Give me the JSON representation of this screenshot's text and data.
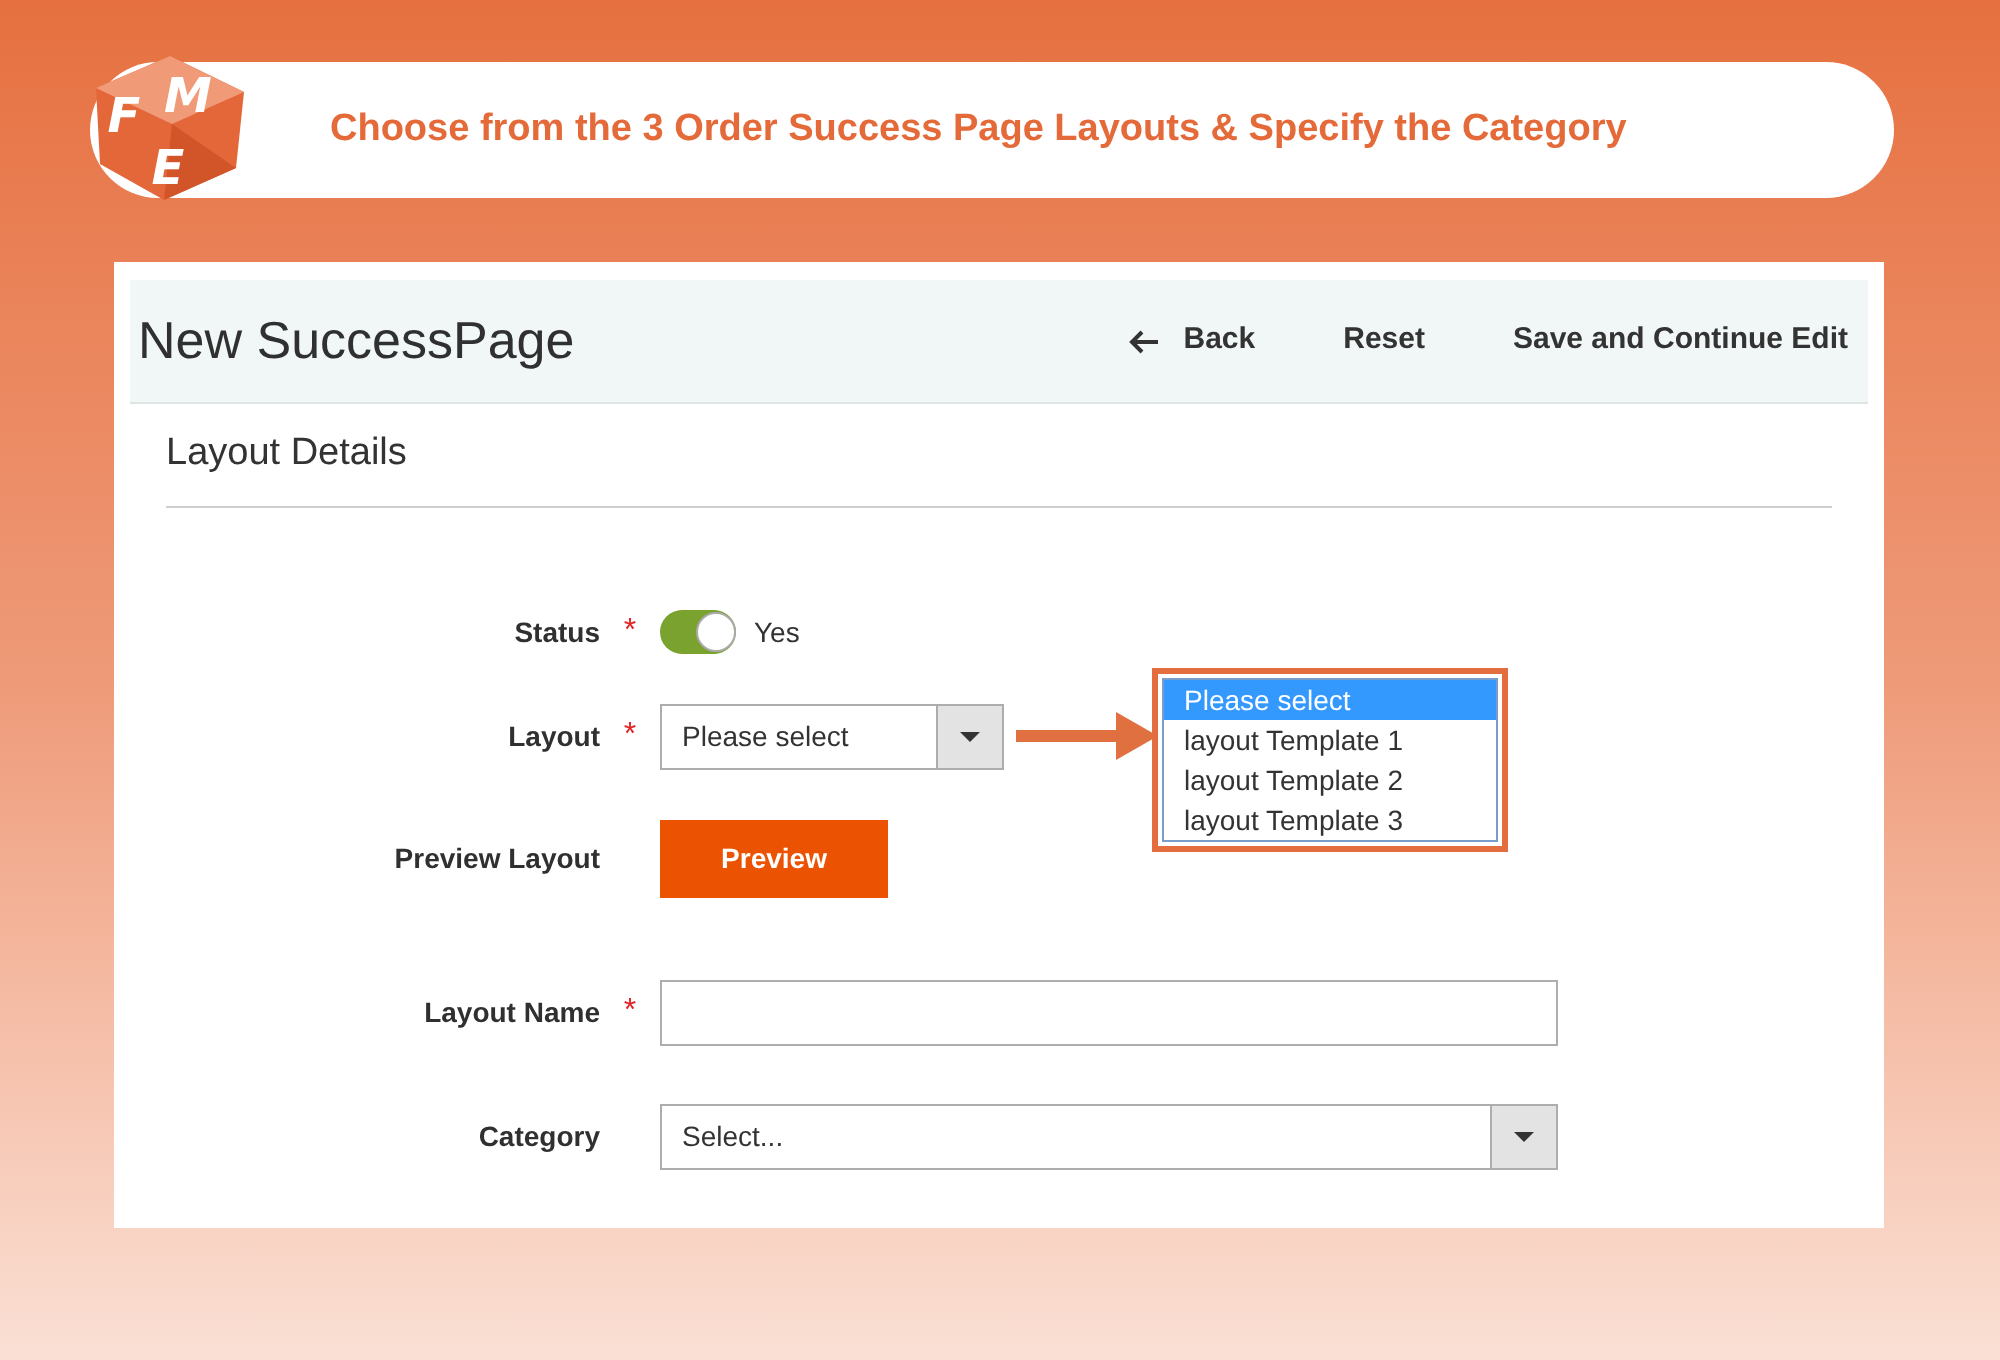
{
  "banner": {
    "logo_letters": [
      "F",
      "M",
      "E"
    ],
    "title": "Choose from the 3 Order Success Page Layouts & Specify the Category"
  },
  "page": {
    "title": "New SuccessPage",
    "actions": [
      {
        "kind": "back",
        "label": "Back"
      },
      {
        "kind": "reset",
        "label": "Reset"
      },
      {
        "kind": "save",
        "label": "Save and Continue Edit"
      }
    ]
  },
  "section": {
    "title": "Layout Details"
  },
  "fields": [
    {
      "kind": "toggle",
      "label": "Status",
      "required_mark": "*",
      "on": true,
      "value": "Yes"
    },
    {
      "kind": "select",
      "label": "Layout",
      "required_mark": "*",
      "value": "Please select",
      "dropdown": {
        "options": [
          {
            "label": "Please select",
            "selected": true
          },
          {
            "label": "layout Template 1",
            "selected": false
          },
          {
            "label": "layout Template 2",
            "selected": false
          },
          {
            "label": "layout Template 3",
            "selected": false
          }
        ]
      }
    },
    {
      "kind": "button",
      "label": "Preview Layout",
      "button": "Preview"
    },
    {
      "kind": "text",
      "label": "Layout Name",
      "required_mark": "*"
    },
    {
      "kind": "select",
      "label": "Category",
      "value": "Select..."
    }
  ]
}
